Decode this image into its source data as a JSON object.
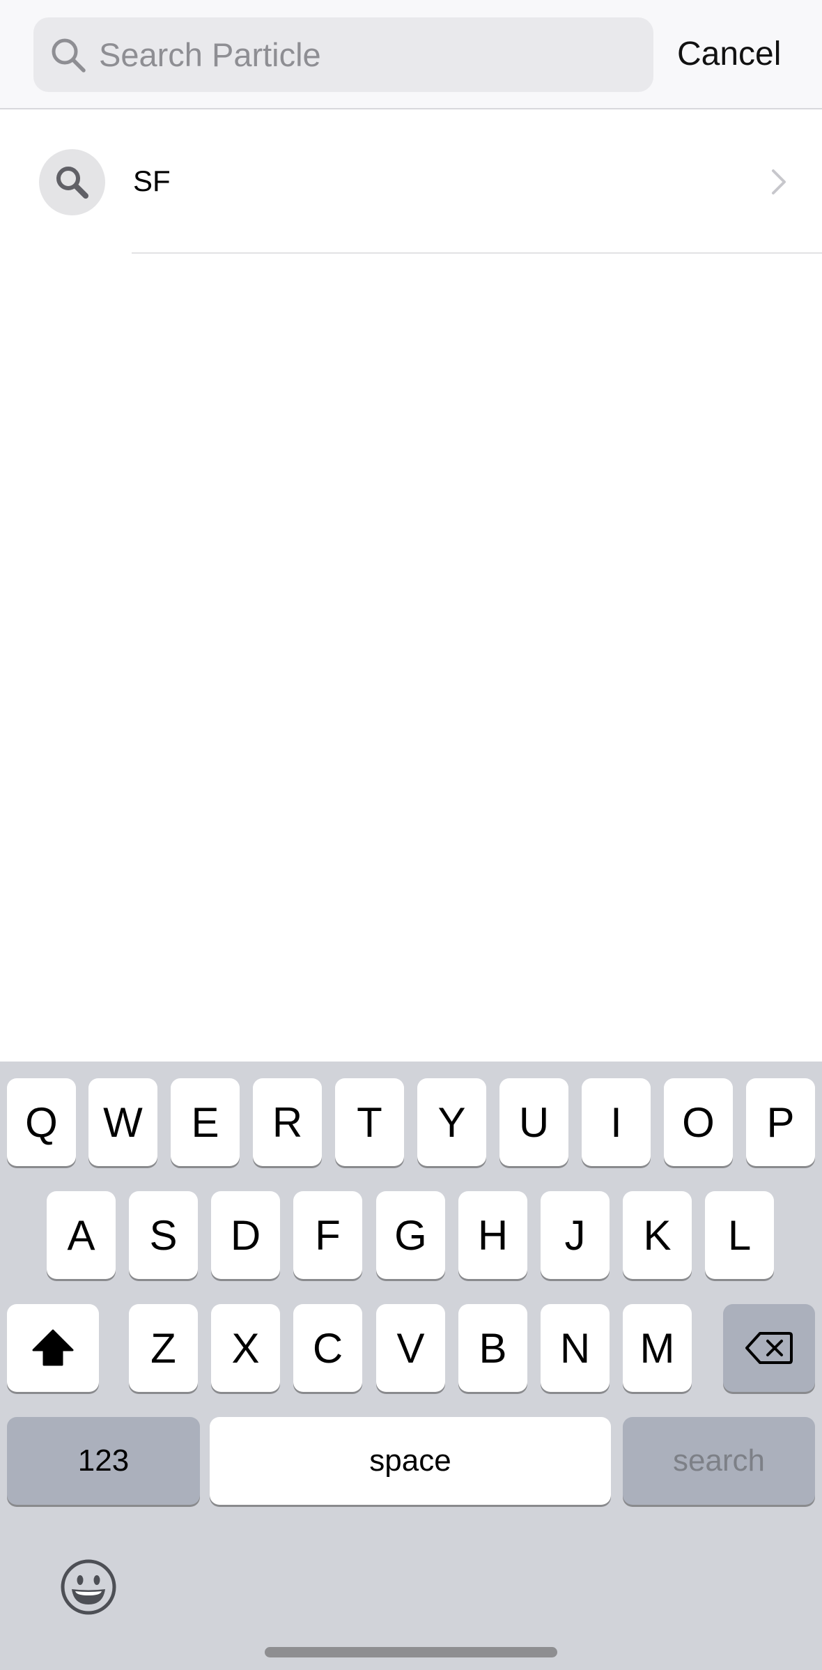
{
  "search": {
    "placeholder": "Search Particle",
    "value": "",
    "cancel_label": "Cancel"
  },
  "results": [
    {
      "label": "SF",
      "icon": "search-icon"
    }
  ],
  "keyboard": {
    "row1": [
      "Q",
      "W",
      "E",
      "R",
      "T",
      "Y",
      "U",
      "I",
      "O",
      "P"
    ],
    "row2": [
      "A",
      "S",
      "D",
      "F",
      "G",
      "H",
      "J",
      "K",
      "L"
    ],
    "row3": [
      "Z",
      "X",
      "C",
      "V",
      "B",
      "N",
      "M"
    ],
    "numbers_label": "123",
    "space_label": "space",
    "search_label": "search",
    "shift_icon": "shift-icon",
    "delete_icon": "delete-icon",
    "emoji_icon": "emoji-icon"
  },
  "colors": {
    "keyboard_bg": "#d1d3d9",
    "key_bg": "#ffffff",
    "function_key_bg": "#abb0bc",
    "search_field_bg": "#e9e9ec"
  }
}
